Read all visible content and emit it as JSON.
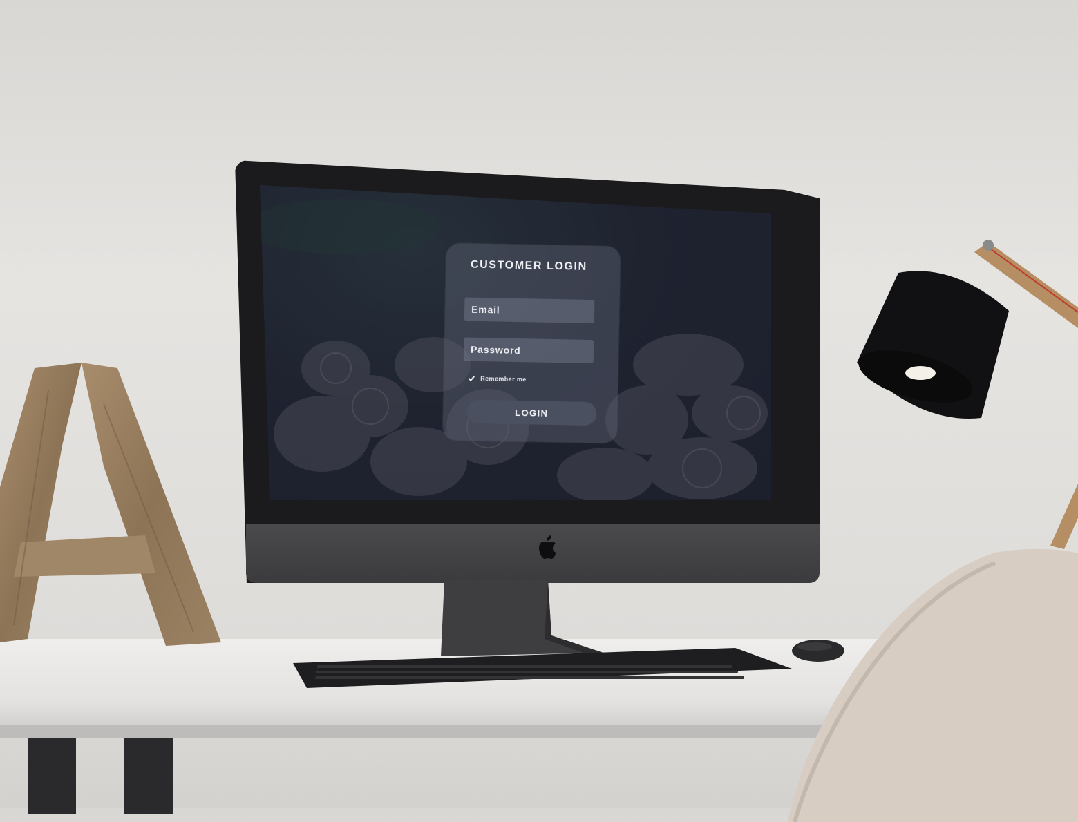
{
  "login": {
    "title": "CUSTOMER LOGIN",
    "email_placeholder": "Email",
    "password_placeholder": "Password",
    "remember_label": "Remember me",
    "remember_checked": true,
    "login_label": "LOGIN"
  },
  "colors": {
    "screen_bg": "#1e2230",
    "card_bg": "#5a6070",
    "button_bg": "#4b5061",
    "text": "#f2f3f6"
  },
  "icons": [
    "apple-logo-icon",
    "check-icon"
  ]
}
